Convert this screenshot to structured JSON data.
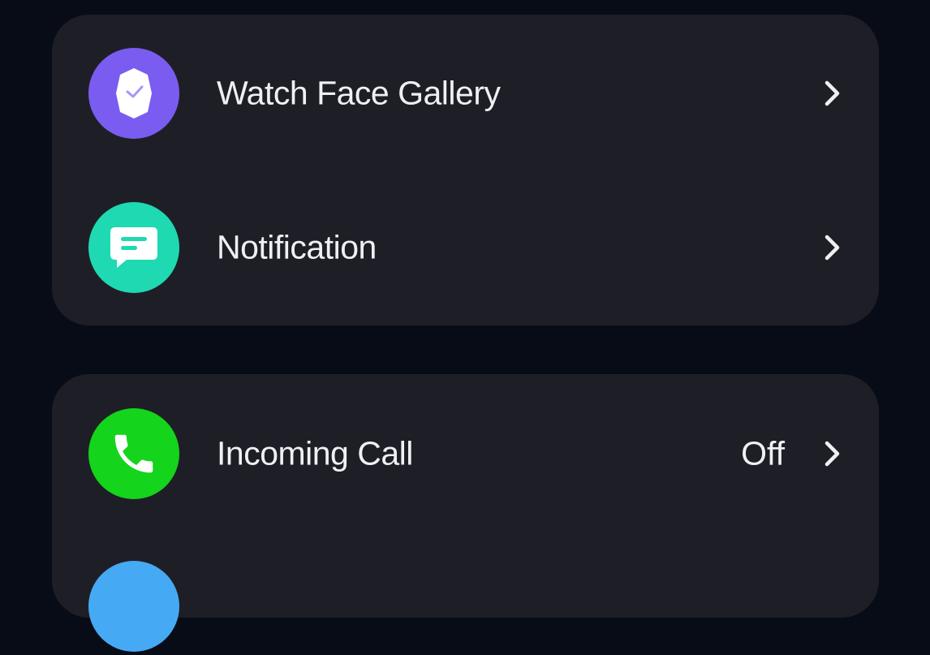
{
  "groups": [
    {
      "items": [
        {
          "label": "Watch Face Gallery",
          "icon": "watch-icon",
          "icon_color": "#7b5cf0",
          "value": ""
        },
        {
          "label": "Notification",
          "icon": "message-icon",
          "icon_color": "#1ed9b1",
          "value": ""
        }
      ]
    },
    {
      "items": [
        {
          "label": "Incoming Call",
          "icon": "phone-icon",
          "icon_color": "#14d41b",
          "value": "Off"
        },
        {
          "label": "",
          "icon": "circle-icon",
          "icon_color": "#46a9f3",
          "value": ""
        }
      ]
    }
  ],
  "colors": {
    "background": "#080c16",
    "card": "#1e1f26",
    "text": "#eef0f3"
  }
}
